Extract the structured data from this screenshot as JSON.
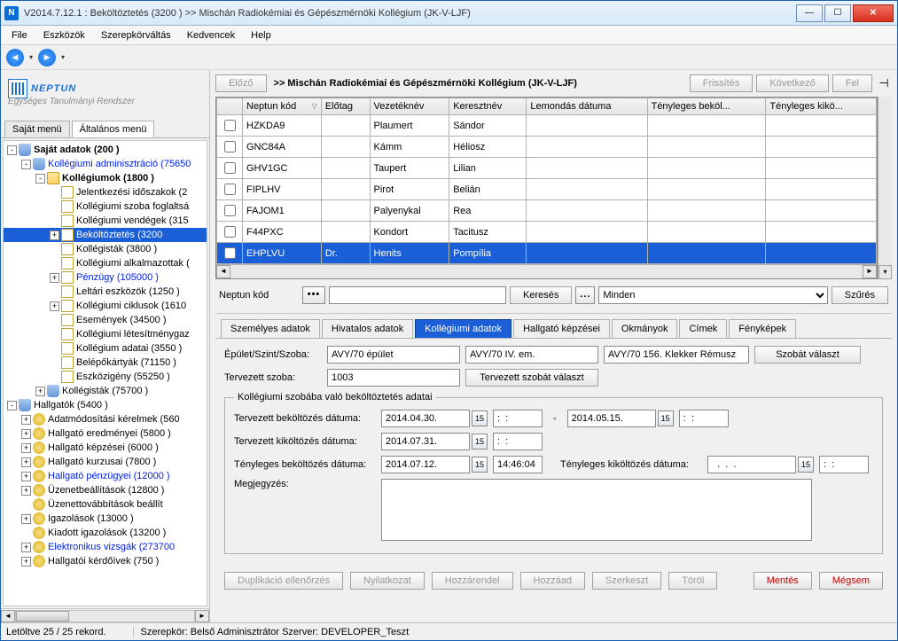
{
  "window": {
    "title": "V2014.7.12.1 : Beköltöztetés (3200  )  >> Mischán Radiokémiai és Gépészmérnöki Kollégium (JK-V-LJF)",
    "icon_letter": "N"
  },
  "menus": [
    "File",
    "Eszközök",
    "Szerepkörváltás",
    "Kedvencek",
    "Help"
  ],
  "logo": {
    "brand": "NEPTUN",
    "tagline": "Egységes Tanulmányi Rendszer"
  },
  "left_tabs": {
    "a": "Saját menü",
    "b": "Általános menü"
  },
  "tree": [
    {
      "d": 0,
      "exp": "-",
      "ic": "db",
      "lbl": "Saját adatok (200  )",
      "bold": true
    },
    {
      "d": 1,
      "exp": "-",
      "ic": "db",
      "lbl": "Kollégiumi adminisztráció (75650",
      "blue": true
    },
    {
      "d": 2,
      "exp": "-",
      "ic": "folder",
      "lbl": "Kollégiumok (1800  )",
      "bold": true
    },
    {
      "d": 3,
      "exp": "",
      "ic": "doc",
      "lbl": "Jelentkezési időszakok (2"
    },
    {
      "d": 3,
      "exp": "",
      "ic": "doc",
      "lbl": "Kollégiumi szoba foglaltsá"
    },
    {
      "d": 3,
      "exp": "",
      "ic": "doc",
      "lbl": "Kollégiumi vendégek (315"
    },
    {
      "d": 3,
      "exp": "+",
      "ic": "doc",
      "lbl": "Beköltöztetés (3200",
      "sel": true
    },
    {
      "d": 3,
      "exp": "",
      "ic": "doc",
      "lbl": "Kollégisták (3800  )"
    },
    {
      "d": 3,
      "exp": "",
      "ic": "doc",
      "lbl": "Kollégiumi alkalmazottak ("
    },
    {
      "d": 3,
      "exp": "+",
      "ic": "doc",
      "lbl": "Pénzügy (105000  )",
      "blue": true
    },
    {
      "d": 3,
      "exp": "",
      "ic": "doc",
      "lbl": "Leltári eszközök (1250  )"
    },
    {
      "d": 3,
      "exp": "+",
      "ic": "doc",
      "lbl": "Kollégiumi ciklusok (1610"
    },
    {
      "d": 3,
      "exp": "",
      "ic": "doc",
      "lbl": "Események (34500  )"
    },
    {
      "d": 3,
      "exp": "",
      "ic": "doc",
      "lbl": "Kollégiumi létesítménygaz"
    },
    {
      "d": 3,
      "exp": "",
      "ic": "doc",
      "lbl": "Kollégium adatai (3550  )"
    },
    {
      "d": 3,
      "exp": "",
      "ic": "doc",
      "lbl": "Belépőkártyák (71150  )"
    },
    {
      "d": 3,
      "exp": "",
      "ic": "doc",
      "lbl": "Eszközigény (55250  )"
    },
    {
      "d": 2,
      "exp": "+",
      "ic": "db",
      "lbl": "Kollégisták (75700  )"
    },
    {
      "d": 0,
      "exp": "-",
      "ic": "db",
      "lbl": "Hallgatók (5400  )"
    },
    {
      "d": 1,
      "exp": "+",
      "ic": "gear",
      "lbl": "Adatmódosítási kérelmek (560"
    },
    {
      "d": 1,
      "exp": "+",
      "ic": "gear",
      "lbl": "Hallgató eredményei (5800  )"
    },
    {
      "d": 1,
      "exp": "+",
      "ic": "gear",
      "lbl": "Hallgató képzései (6000  )"
    },
    {
      "d": 1,
      "exp": "+",
      "ic": "gear",
      "lbl": "Hallgató kurzusai (7800  )"
    },
    {
      "d": 1,
      "exp": "+",
      "ic": "gear",
      "lbl": "Hallgató pénzügyei (12000  )",
      "blue": true
    },
    {
      "d": 1,
      "exp": "+",
      "ic": "gear",
      "lbl": "Üzenetbeállítások (12800  )"
    },
    {
      "d": 1,
      "exp": "",
      "ic": "gear",
      "lbl": "Üzenettovábbítások beállít"
    },
    {
      "d": 1,
      "exp": "+",
      "ic": "gear",
      "lbl": "Igazolások (13000  )"
    },
    {
      "d": 1,
      "exp": "",
      "ic": "gear",
      "lbl": "Kiadott igazolások (13200  )"
    },
    {
      "d": 1,
      "exp": "+",
      "ic": "gear",
      "lbl": "Elektronikus vizsgák (273700",
      "blue": true
    },
    {
      "d": 1,
      "exp": "+",
      "ic": "gear",
      "lbl": "Hallgatói kérdőívek (750  )"
    }
  ],
  "right_head": {
    "prev": "Előző",
    "crumb": ">> Mischán Radiokémiai és Gépészmérnöki Kollégium (JK-V-LJF)",
    "refresh": "Frissítés",
    "next": "Következő",
    "up": "Fel"
  },
  "grid": {
    "cols": [
      "",
      "Neptun kód",
      "Előtag",
      "Vezetéknév",
      "Keresztnév",
      "Lemondás dátuma",
      "Tényleges beköl...",
      "Tényleges kikö..."
    ],
    "rows": [
      {
        "c": [
          "HZKDA9",
          "",
          "Plaumert",
          "Sándor",
          "",
          "",
          ""
        ]
      },
      {
        "c": [
          "GNC84A",
          "",
          "Kámm",
          "Héliosz",
          "",
          "",
          ""
        ]
      },
      {
        "c": [
          "GHV1GC",
          "",
          "Taupert",
          "Lilian",
          "",
          "",
          ""
        ]
      },
      {
        "c": [
          "FIPLHV",
          "",
          "Pirot",
          "Belián",
          "",
          "",
          ""
        ]
      },
      {
        "c": [
          "FAJOM1",
          "",
          "Palyenykal",
          "Rea",
          "",
          "",
          ""
        ]
      },
      {
        "c": [
          "F44PXC",
          "",
          "Kondort",
          "Tacitusz",
          "",
          "",
          ""
        ]
      },
      {
        "c": [
          "EHPLVU",
          "Dr.",
          "Henits",
          "Pompília",
          "",
          "",
          ""
        ],
        "sel": true
      }
    ]
  },
  "search": {
    "label": "Neptun kód",
    "value": "",
    "btn": "Keresés",
    "filter_sel": "Minden",
    "filter_btn": "Szűrés"
  },
  "dtabs": [
    "Személyes adatok",
    "Hivatalos adatok",
    "Kollégiumi adatok",
    "Hallgató képzései",
    "Okmányok",
    "Címek",
    "Fényképek"
  ],
  "form": {
    "loc_label": "Épület/Szint/Szoba:",
    "loc1": "AVY/70 épület",
    "loc2": "AVY/70 IV. em.",
    "loc3": "AVY/70 156. Klekker Rémusz",
    "loc_btn": "Szobát választ",
    "planned_label": "Tervezett szoba:",
    "planned_val": "1003",
    "planned_btn": "Tervezett szobát választ",
    "fs_legend": "Kollégiumi szobába való beköltöztetés adatai",
    "r1_label": "Tervezett beköltözés dátuma:",
    "r1_d": "2014.04.30.",
    "r1_sep": "-",
    "r1_d2": "2014.05.15.",
    "r2_label": "Tervezett kiköltözés dátuma:",
    "r2_d": "2014.07.31.",
    "r3_label": "Tényleges beköltözés dátuma:",
    "r3_d": "2014.07.12.",
    "r3_t": "14:46:04",
    "r3b_label": "Tényleges kiköltözés dátuma:",
    "r3b_d": "  .  .  .",
    "memo_label": "Megjegyzés:",
    "time_empty": ":  :"
  },
  "bottom": {
    "dup": "Duplikáció ellenőrzés",
    "nyil": "Nyilatkozat",
    "hozr": "Hozzárendel",
    "hozad": "Hozzáad",
    "szerk": "Szerkeszt",
    "torol": "Töröl",
    "mentes": "Mentés",
    "megsem": "Mégsem"
  },
  "status": {
    "left": "Letöltve 25 / 25 rekord.",
    "role": "Szerepkör: Belső Adminisztrátor   Szerver: DEVELOPER_Teszt"
  }
}
